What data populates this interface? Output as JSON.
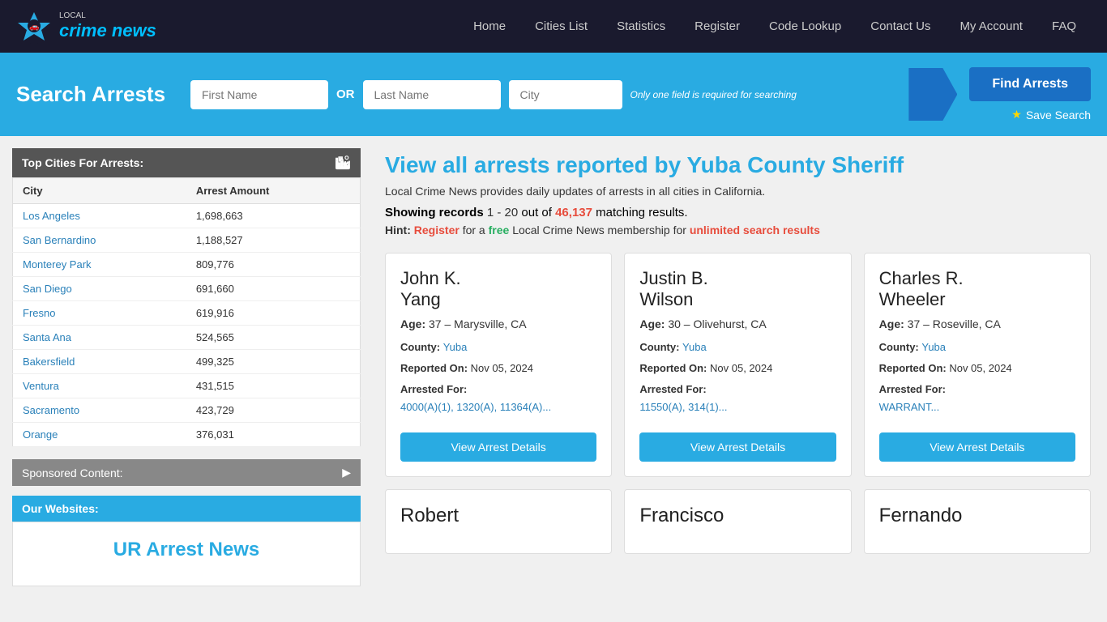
{
  "nav": {
    "brand": "crime news",
    "brand_sub": "LOCAL",
    "links": [
      {
        "label": "Home",
        "id": "nav-home"
      },
      {
        "label": "Cities List",
        "id": "nav-cities-list"
      },
      {
        "label": "Statistics",
        "id": "nav-statistics"
      },
      {
        "label": "Register",
        "id": "nav-register"
      },
      {
        "label": "Code Lookup",
        "id": "nav-code-lookup"
      },
      {
        "label": "Contact Us",
        "id": "nav-contact-us"
      },
      {
        "label": "My Account",
        "id": "nav-my-account"
      },
      {
        "label": "FAQ",
        "id": "nav-faq"
      }
    ]
  },
  "search": {
    "title": "Search Arrests",
    "first_name_placeholder": "First Name",
    "last_name_placeholder": "Last Name",
    "city_placeholder": "City",
    "or_label": "OR",
    "hint": "Only one field is required for searching",
    "find_btn": "Find Arrests",
    "save_btn": "Save Search"
  },
  "sidebar": {
    "top_cities_header": "Top Cities For Arrests:",
    "table_headers": [
      "City",
      "Arrest Amount"
    ],
    "cities": [
      {
        "city": "Los Angeles",
        "count": "1,698,663"
      },
      {
        "city": "San Bernardino",
        "count": "1,188,527"
      },
      {
        "city": "Monterey Park",
        "count": "809,776"
      },
      {
        "city": "San Diego",
        "count": "691,660"
      },
      {
        "city": "Fresno",
        "count": "619,916"
      },
      {
        "city": "Santa Ana",
        "count": "524,565"
      },
      {
        "city": "Bakersfield",
        "count": "499,325"
      },
      {
        "city": "Ventura",
        "count": "431,515"
      },
      {
        "city": "Sacramento",
        "count": "423,729"
      },
      {
        "city": "Orange",
        "count": "376,031"
      }
    ],
    "sponsored_header": "Sponsored Content:",
    "our_websites_header": "Our Websites:",
    "ur_arrest_news": "UR Arrest News"
  },
  "content": {
    "page_title": "View all arrests reported by Yuba County Sheriff",
    "description": "Local Crime News provides daily updates of arrests in all cities in California.",
    "showing_label": "Showing records",
    "range": "1 - 20",
    "out_of": "out of",
    "total": "46,137",
    "matching": "matching results.",
    "hint_label": "Hint:",
    "hint_register": "Register",
    "hint_text1": "for a",
    "hint_free": "free",
    "hint_text2": "Local Crime News membership for",
    "hint_unlimited": "unlimited search results",
    "view_arrest_details": "View Arrest Details",
    "cards": [
      {
        "name": "John K.\nYang",
        "age": "37",
        "location": "Marysville, CA",
        "county": "Yuba",
        "reported_on": "Nov 05, 2024",
        "arrested_for_label": "Arrested For:",
        "charges": "4000(A)(1), 1320(A), 11364(A)..."
      },
      {
        "name": "Justin B.\nWilson",
        "age": "30",
        "location": "Olivehurst, CA",
        "county": "Yuba",
        "reported_on": "Nov 05, 2024",
        "arrested_for_label": "Arrested For:",
        "charges": "11550(A), 314(1)..."
      },
      {
        "name": "Charles R.\nWheeler",
        "age": "37",
        "location": "Roseville, CA",
        "county": "Yuba",
        "reported_on": "Nov 05, 2024",
        "arrested_for_label": "Arrested For:",
        "charges": "WARRANT..."
      }
    ],
    "bottom_names": [
      {
        "name": "Robert"
      },
      {
        "name": "Francisco"
      },
      {
        "name": "Fernando"
      }
    ]
  }
}
